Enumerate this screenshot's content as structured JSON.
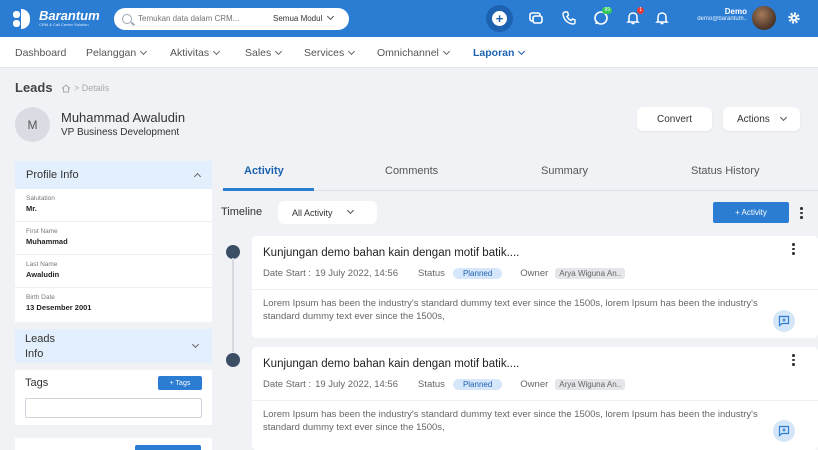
{
  "topbar": {
    "app_name": "Barantum",
    "app_tagline": "CRM & Call Center Solution",
    "search_placeholder": "Temukan data dalam CRM...",
    "search_module": "Semua Modul",
    "user_name": "Demo",
    "user_email": "demo@barantum..",
    "badges": {
      "whatsapp": "99",
      "notifications": "1"
    }
  },
  "nav": {
    "items": [
      {
        "label": "Dashboard"
      },
      {
        "label": "Pelanggan"
      },
      {
        "label": "Aktivitas"
      },
      {
        "label": "Sales"
      },
      {
        "label": "Services"
      },
      {
        "label": "Omnichannel"
      },
      {
        "label": "Laporan"
      }
    ]
  },
  "page": {
    "title": "Leads",
    "breadcrumb": "> Details",
    "avatar_initial": "M",
    "lead_name": "Muhammad Awaludin",
    "lead_title": "VP Business Development",
    "convert_label": "Convert",
    "actions_label": "Actions"
  },
  "profile": {
    "title": "Profile Info",
    "fields": [
      {
        "label": "Salutation",
        "value": "Mr."
      },
      {
        "label": "First Name",
        "value": "Muhammad"
      },
      {
        "label": "Last Name",
        "value": "Awaludin"
      },
      {
        "label": "Birth Date",
        "value": "13 Desember 2001"
      }
    ]
  },
  "leads_info": {
    "title_line1": "Leads",
    "title_line2": "Info"
  },
  "tags": {
    "label": "Tags",
    "add_label": "+ Tags"
  },
  "tabs": [
    {
      "label": "Activity"
    },
    {
      "label": "Comments"
    },
    {
      "label": "Summary"
    },
    {
      "label": "Status History"
    }
  ],
  "timeline": {
    "label": "Timeline",
    "filter": "All Activity",
    "add_label": "+ Activity",
    "activities": [
      {
        "title": "Kunjungan demo bahan kain dengan motif batik....",
        "date_label": "Date Start :",
        "date": "19 July 2022, 14:56",
        "status_label": "Status",
        "status": "Planned",
        "owner_label": "Owner",
        "owner": "Arya Wiguna An..",
        "description": "Lorem Ipsum has been the industry's standard dummy text ever since the 1500s, lorem Ipsum has been the industry's standard dummy text ever since the 1500s,"
      },
      {
        "title": "Kunjungan demo bahan kain dengan motif batik....",
        "date_label": "Date Start :",
        "date": "19 July 2022, 14:56",
        "status_label": "Status",
        "status": "Planned",
        "owner_label": "Owner",
        "owner": "Arya Wiguna An..",
        "description": "Lorem Ipsum has been the industry's standard dummy text ever since the 1500s, lorem Ipsum has been the industry's standard dummy text ever since the 1500s,"
      }
    ]
  },
  "colors": {
    "primary": "#2b7dd3",
    "dark_primary": "#1d62b0",
    "panel_head": "#e3effc",
    "background": "#f0f2f5"
  }
}
